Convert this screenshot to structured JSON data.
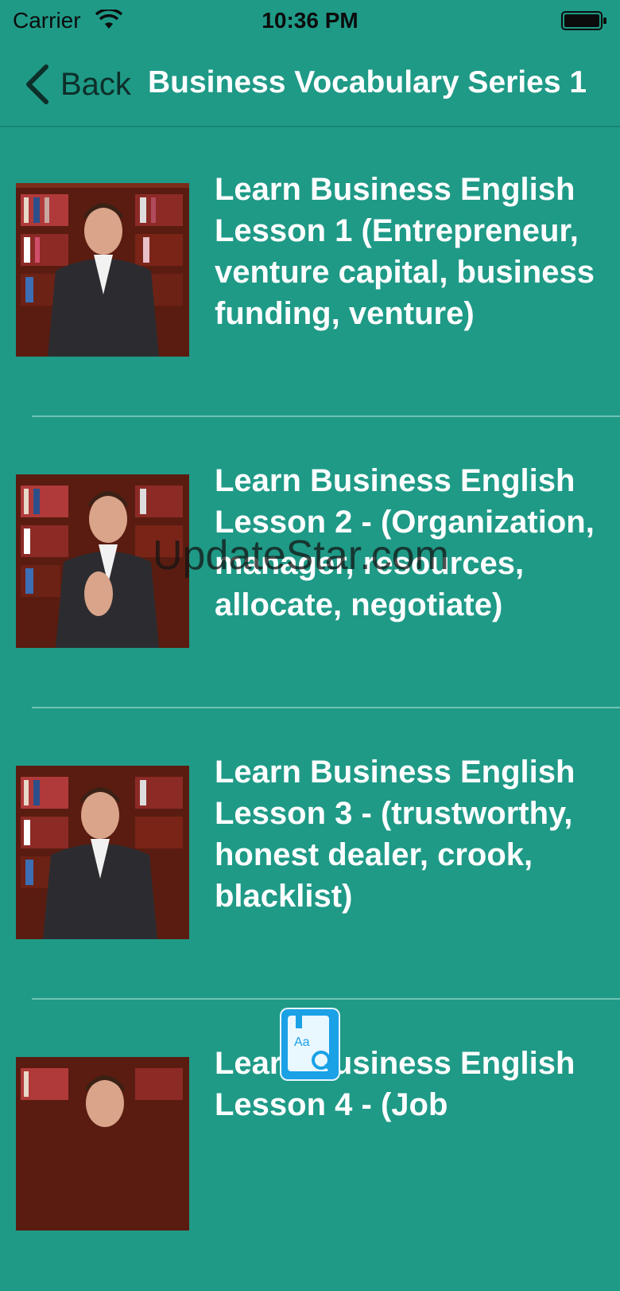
{
  "status_bar": {
    "carrier": "Carrier",
    "time": "10:36 PM"
  },
  "nav": {
    "back_label": "Back",
    "title": "Business Vocabulary Series 1"
  },
  "lessons": [
    {
      "title": "Learn Business English Lesson 1 (Entrepreneur, venture capital, business funding, venture)"
    },
    {
      "title": "Learn Business English Lesson 2 - (Organization, manager, resources, allocate, negotiate)"
    },
    {
      "title": "Learn Business English Lesson 3 - (trustworthy, honest dealer, crook, blacklist)"
    },
    {
      "title": "Learn Business English Lesson 4 - (Job"
    }
  ],
  "watermark": "UpdateStar.com",
  "colors": {
    "background": "#1f9a87",
    "text": "#ffffff",
    "separator": "#6fc2b4"
  }
}
